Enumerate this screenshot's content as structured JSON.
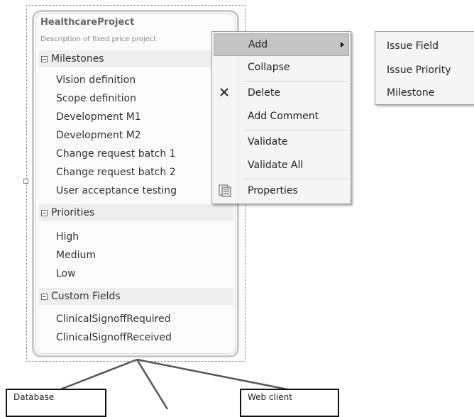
{
  "shape": {
    "title": "HealthcareProject",
    "description": "Description of fixed price project",
    "compartments": [
      {
        "label": "Milestones",
        "items": [
          "Vision definition",
          "Scope definition",
          "Development M1",
          "Development M2",
          "Change request batch 1",
          "Change request batch 2",
          "User acceptance testing"
        ]
      },
      {
        "label": "Priorities",
        "items": [
          "High",
          "Medium",
          "Low"
        ]
      },
      {
        "label": "Custom Fields",
        "items": [
          "ClinicalSignoffRequired",
          "ClinicalSignoffReceived"
        ]
      }
    ]
  },
  "connected_boxes": {
    "database": "Database",
    "web_client": "Web client"
  },
  "context_menu": {
    "items": [
      "Add",
      "Collapse",
      "Delete",
      "Add Comment",
      "Validate",
      "Validate All",
      "Properties"
    ],
    "highlighted": "Add",
    "icons": {
      "delete": "close-x-icon",
      "properties": "properties-icon",
      "submenu": "submenu-arrow-icon"
    }
  },
  "submenu": {
    "items": [
      "Issue Field",
      "Issue Priority",
      "Milestone"
    ]
  },
  "colors": {
    "menu_background": "#f5f5f5",
    "menu_highlight": "#c4c4c4",
    "shape_border": "#c9c9c9",
    "compartment_header": "#eeeeee"
  }
}
